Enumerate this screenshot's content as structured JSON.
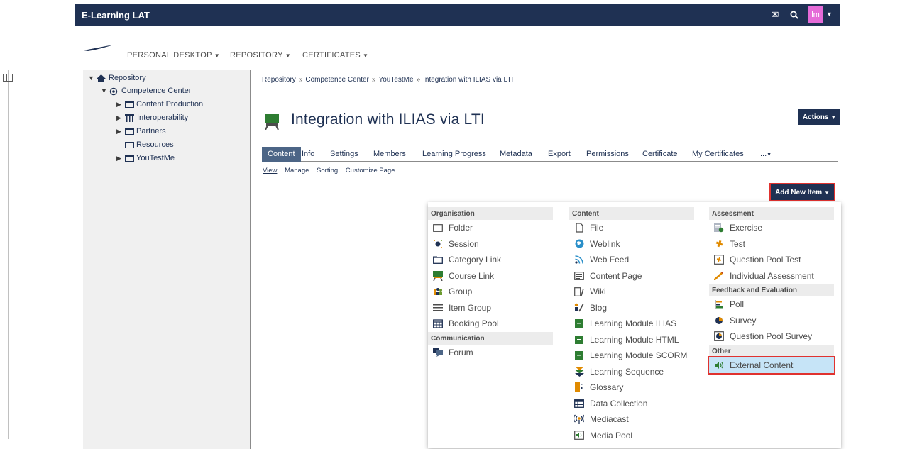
{
  "app": {
    "title": "E-Learning LAT",
    "avatar_initials": "lm"
  },
  "mainnav": {
    "items": [
      {
        "label": "PERSONAL DESKTOP"
      },
      {
        "label": "REPOSITORY"
      },
      {
        "label": "CERTIFICATES"
      }
    ]
  },
  "tree": {
    "items": [
      {
        "label": "Repository"
      },
      {
        "label": "Competence Center"
      },
      {
        "label": "Content Production"
      },
      {
        "label": "Interoperability"
      },
      {
        "label": "Partners"
      },
      {
        "label": "Resources"
      },
      {
        "label": "YouTestMe"
      }
    ]
  },
  "breadcrumb": {
    "items": [
      "Repository",
      "Competence Center",
      "YouTestMe",
      "Integration with ILIAS via LTI"
    ],
    "separator": "»"
  },
  "page": {
    "title": "Integration with ILIAS via LTI",
    "actions_label": "Actions"
  },
  "tabs": {
    "items": [
      "Content",
      "Info",
      "Settings",
      "Members",
      "Learning Progress",
      "Metadata",
      "Export",
      "Permissions",
      "Certificate",
      "My Certificates",
      "..."
    ]
  },
  "subtabs": {
    "items": [
      "View",
      "Manage",
      "Sorting",
      "Customize Page"
    ]
  },
  "add_new_item": {
    "label": "Add New Item"
  },
  "dropdown": {
    "organisation": {
      "header": "Organisation",
      "items": [
        {
          "label": "Folder",
          "icon": "folder-icon"
        },
        {
          "label": "Session",
          "icon": "session-icon"
        },
        {
          "label": "Category Link",
          "icon": "category-link-icon"
        },
        {
          "label": "Course Link",
          "icon": "course-link-icon"
        },
        {
          "label": "Group",
          "icon": "group-icon"
        },
        {
          "label": "Item Group",
          "icon": "item-group-icon"
        },
        {
          "label": "Booking Pool",
          "icon": "booking-pool-icon"
        }
      ]
    },
    "communication": {
      "header": "Communication",
      "items": [
        {
          "label": "Forum",
          "icon": "forum-icon"
        }
      ]
    },
    "content": {
      "header": "Content",
      "items": [
        {
          "label": "File",
          "icon": "file-icon"
        },
        {
          "label": "Weblink",
          "icon": "weblink-icon"
        },
        {
          "label": "Web Feed",
          "icon": "rss-icon"
        },
        {
          "label": "Content Page",
          "icon": "content-page-icon"
        },
        {
          "label": "Wiki",
          "icon": "wiki-icon"
        },
        {
          "label": "Blog",
          "icon": "blog-icon"
        },
        {
          "label": "Learning Module ILIAS",
          "icon": "learning-module-icon"
        },
        {
          "label": "Learning Module HTML",
          "icon": "learning-module-icon"
        },
        {
          "label": "Learning Module SCORM",
          "icon": "learning-module-icon"
        },
        {
          "label": "Learning Sequence",
          "icon": "learning-sequence-icon"
        },
        {
          "label": "Glossary",
          "icon": "glossary-icon"
        },
        {
          "label": "Data Collection",
          "icon": "data-collection-icon"
        },
        {
          "label": "Mediacast",
          "icon": "mediacast-icon"
        },
        {
          "label": "Media Pool",
          "icon": "media-pool-icon"
        }
      ]
    },
    "assessment": {
      "header": "Assessment",
      "items": [
        {
          "label": "Exercise",
          "icon": "exercise-icon"
        },
        {
          "label": "Test",
          "icon": "test-icon"
        },
        {
          "label": "Question Pool Test",
          "icon": "question-pool-test-icon"
        },
        {
          "label": "Individual Assessment",
          "icon": "individual-assessment-icon"
        }
      ]
    },
    "feedback": {
      "header": "Feedback and Evaluation",
      "items": [
        {
          "label": "Poll",
          "icon": "poll-icon"
        },
        {
          "label": "Survey",
          "icon": "survey-icon"
        },
        {
          "label": "Question Pool Survey",
          "icon": "question-pool-survey-icon"
        }
      ]
    },
    "other": {
      "header": "Other",
      "items": [
        {
          "label": "External Content",
          "icon": "external-content-icon"
        }
      ]
    }
  },
  "colors": {
    "primary": "#1f3153",
    "accent_tab": "#4c6586",
    "highlight": "#c6e4f7",
    "callout": "#e0322f"
  }
}
